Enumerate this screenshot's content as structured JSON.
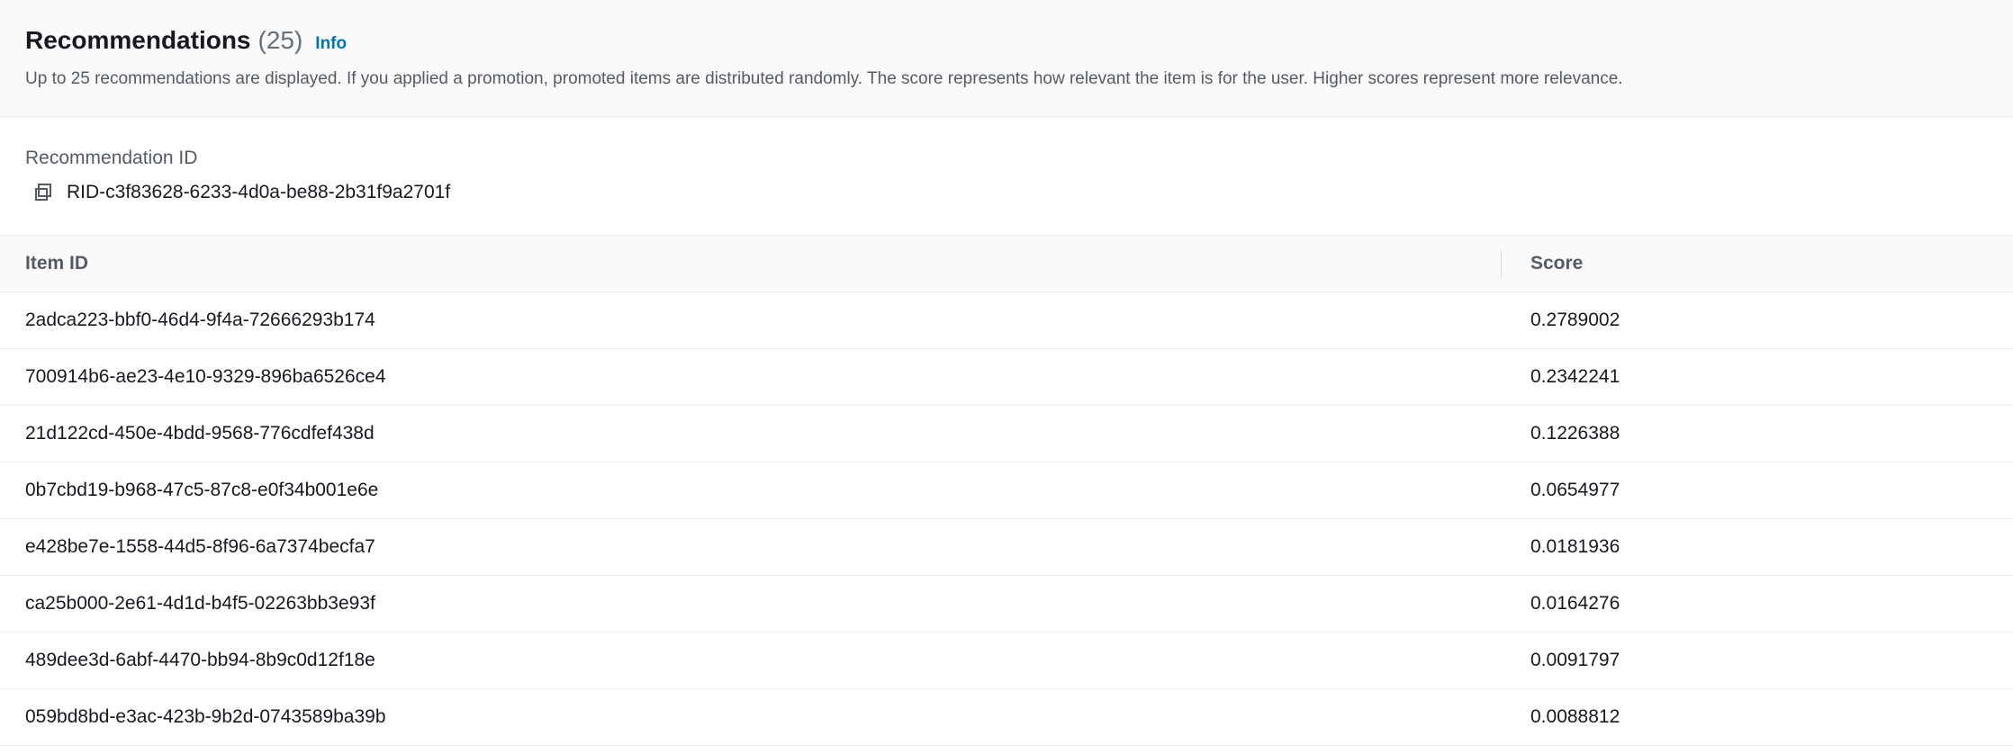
{
  "header": {
    "title": "Recommendations",
    "count": "(25)",
    "info_label": "Info",
    "description": "Up to 25 recommendations are displayed. If you applied a promotion, promoted items are distributed randomly. The score represents how relevant the item is for the user. Higher scores represent more relevance."
  },
  "recommendation": {
    "label": "Recommendation ID",
    "id": "RID-c3f83628-6233-4d0a-be88-2b31f9a2701f",
    "copy_icon": "copy-icon"
  },
  "table": {
    "columns": [
      "Item ID",
      "Score"
    ],
    "rows": [
      {
        "item_id": "2adca223-bbf0-46d4-9f4a-72666293b174",
        "score": "0.2789002"
      },
      {
        "item_id": "700914b6-ae23-4e10-9329-896ba6526ce4",
        "score": "0.2342241"
      },
      {
        "item_id": "21d122cd-450e-4bdd-9568-776cdfef438d",
        "score": "0.1226388"
      },
      {
        "item_id": "0b7cbd19-b968-47c5-87c8-e0f34b001e6e",
        "score": "0.0654977"
      },
      {
        "item_id": "e428be7e-1558-44d5-8f96-6a7374becfa7",
        "score": "0.0181936"
      },
      {
        "item_id": "ca25b000-2e61-4d1d-b4f5-02263bb3e93f",
        "score": "0.0164276"
      },
      {
        "item_id": "489dee3d-6abf-4470-bb94-8b9c0d12f18e",
        "score": "0.0091797"
      },
      {
        "item_id": "059bd8bd-e3ac-423b-9b2d-0743589ba39b",
        "score": "0.0088812"
      }
    ]
  },
  "colors": {
    "link": "#0073bb",
    "header_bg": "#fafafa",
    "border": "#eaeded",
    "text_primary": "#16191f",
    "text_secondary": "#545b64"
  }
}
